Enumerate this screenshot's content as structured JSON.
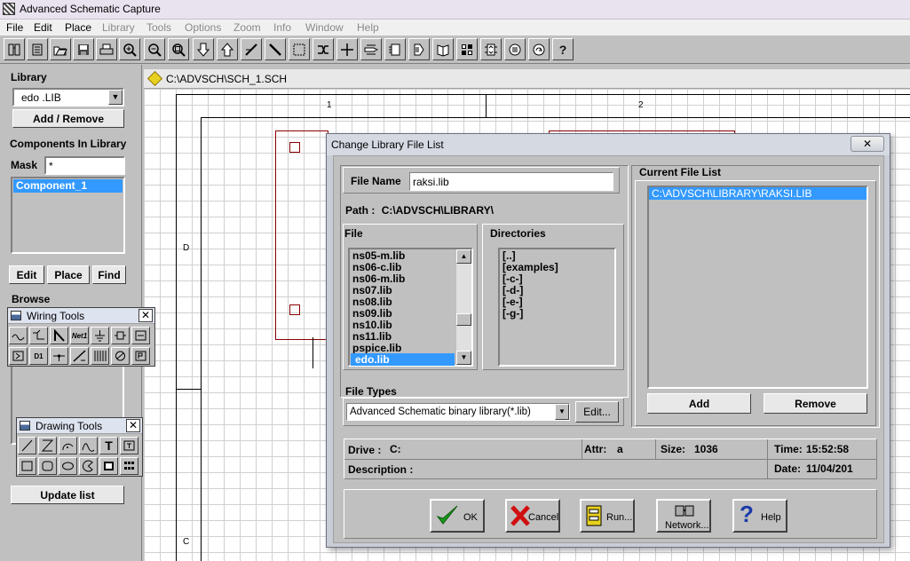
{
  "app": {
    "title": "Advanced Schematic Capture"
  },
  "menu": {
    "items": [
      "File",
      "Edit",
      "Place",
      "Library",
      "Tools",
      "Options",
      "Zoom",
      "Info",
      "Window",
      "Help"
    ]
  },
  "toolbar": {
    "icons": [
      "new-sheet-icon",
      "open-library-icon",
      "open-folder-icon",
      "save-icon",
      "print-icon",
      "zoom-in-icon",
      "zoom-out-icon",
      "zoom-area-icon",
      "move-down-icon",
      "move-up-icon",
      "wire-tool-icon",
      "bus-tool-icon",
      "select-box-icon",
      "cross-probe-icon",
      "junction-icon",
      "port-icon",
      "sheet-symbol-icon",
      "part-icon",
      "annotate-icon",
      "netlist-icon",
      "erc-icon",
      "undo-icon",
      "redo-icon",
      "help-icon"
    ]
  },
  "leftpanel": {
    "library_label": "Library",
    "library_value": "edo  .LIB",
    "add_remove": "Add / Remove",
    "components_label": "Components In Library",
    "mask_label": "Mask",
    "mask_value": "*",
    "components": [
      "Component_1"
    ],
    "edit": "Edit",
    "place": "Place",
    "find": "Find",
    "browse_label": "Browse",
    "update_list": "Update list"
  },
  "wiring_tools": {
    "title": "Wiring Tools",
    "close": "✕",
    "net_label": "Net1",
    "power_label": "D1"
  },
  "drawing_tools": {
    "title": "Drawing Tools",
    "close": "✕",
    "text_glyph": "T"
  },
  "schematic": {
    "tab_title": "C:\\ADVSCH\\SCH_1.SCH",
    "col_labels": [
      "1",
      "2"
    ],
    "row_labels": [
      "D",
      "C"
    ]
  },
  "dialog": {
    "title": "Change Library File List",
    "close": "✕",
    "file_name_label": "File Name",
    "file_name_value": "raksi.lib",
    "path_label": "Path :",
    "path_value": "C:\\ADVSCH\\LIBRARY\\",
    "file_label": "File",
    "files": [
      "ns05-m.lib",
      "ns06-c.lib",
      "ns06-m.lib",
      "ns07.lib",
      "ns08.lib",
      "ns09.lib",
      "ns10.lib",
      "ns11.lib",
      "pspice.lib",
      "edo.lib"
    ],
    "selected_file": "edo.lib",
    "directories_label": "Directories",
    "directories": [
      "[..]",
      "[examples]",
      "[-c-]",
      "[-d-]",
      "[-e-]",
      "[-g-]"
    ],
    "file_types_label": "File Types",
    "file_types_value": "Advanced Schematic binary library(*.lib)",
    "edit_button": "Edit...",
    "current_list_label": "Current File List",
    "current_files": [
      "C:\\ADVSCH\\LIBRARY\\RAKSI.LIB"
    ],
    "add_button": "Add",
    "remove_button": "Remove",
    "drive_label": "Drive :",
    "drive_value": "C:",
    "attr_label": "Attr:",
    "attr_value": "a",
    "size_label": "Size:",
    "size_value": "1036",
    "time_label": "Time:",
    "time_value": "15:52:58",
    "description_label": "Description :",
    "date_label": "Date:",
    "date_value": "11/04/201",
    "buttons": {
      "ok": "OK",
      "cancel": "Cancel",
      "run": "Run...",
      "network": "Network...",
      "help": "Help"
    }
  },
  "colors": {
    "face": "#c0c0c0",
    "selection": "#3399ff",
    "schematic_border": "#8b0000",
    "ok_check": "#1a9a1a",
    "cancel_x": "#d01010",
    "help_question": "#1a3aa8"
  }
}
